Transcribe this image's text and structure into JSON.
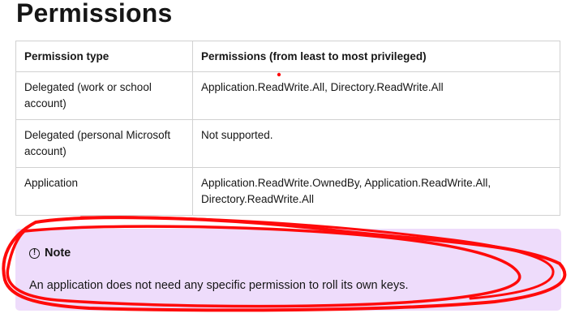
{
  "page": {
    "title": "Permissions"
  },
  "permissions_table": {
    "headers": [
      "Permission type",
      "Permissions (from least to most privileged)"
    ],
    "rows": [
      {
        "type": "Delegated (work or school account)",
        "permissions": "Application.ReadWrite.All, Directory.ReadWrite.All"
      },
      {
        "type": "Delegated (personal Microsoft account)",
        "permissions": "Not supported."
      },
      {
        "type": "Application",
        "permissions": "Application.ReadWrite.OwnedBy, Application.ReadWrite.All, Directory.ReadWrite.All"
      }
    ]
  },
  "note": {
    "icon": "info-icon",
    "label": "Note",
    "text": "An application does not need any specific permission to roll its own keys."
  },
  "annotation": {
    "color": "#ff0a0a",
    "shape": "hand-drawn-circle"
  }
}
